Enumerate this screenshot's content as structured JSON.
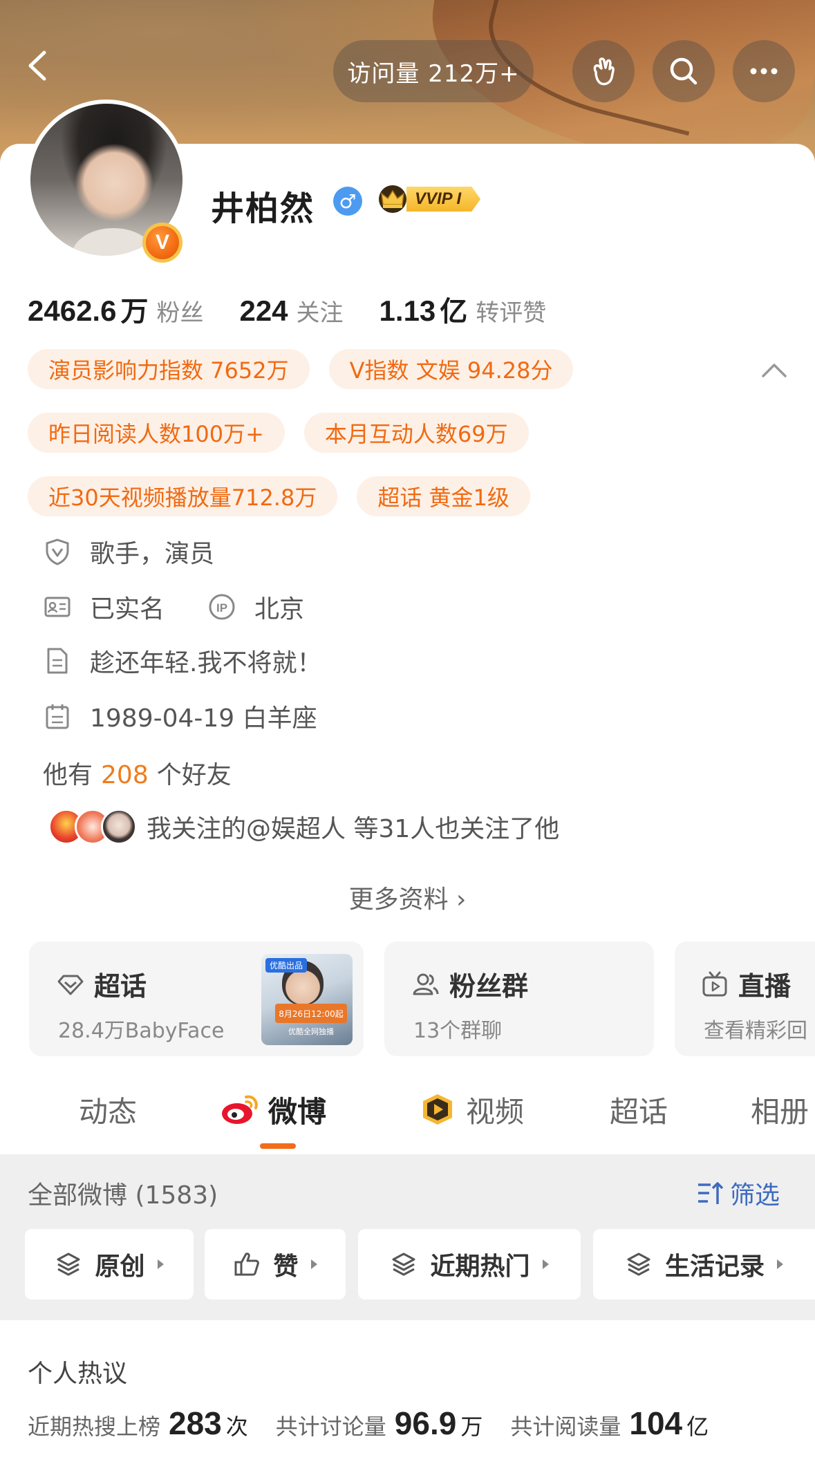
{
  "header": {
    "visit_label": "访问量 212万+"
  },
  "profile": {
    "name": "井柏然",
    "gender_symbol": "♂",
    "vvip_label": "VVIP I",
    "verified_mark": "V"
  },
  "stats": [
    {
      "num": "2462.6",
      "unit": "万",
      "label": "粉丝"
    },
    {
      "num": "224",
      "unit": "",
      "label": "关注"
    },
    {
      "num": "1.13",
      "unit": "亿",
      "label": "转评赞"
    }
  ],
  "tags": {
    "row1": [
      "演员影响力指数 7652万",
      "V指数 文娱 94.28分"
    ],
    "row2": [
      "昨日阅读人数100万+",
      "本月互动人数69万"
    ],
    "row3": [
      "近30天视频播放量712.8万",
      "超话 黄金1级"
    ]
  },
  "info": {
    "occupation": "歌手，演员",
    "real_name": "已实名",
    "ip_location": "北京",
    "bio": "趁还年轻.我不将就！",
    "birthday": "1989-04-19 白羊座"
  },
  "friends": {
    "prefix": "他有",
    "count": "208",
    "suffix": "个好友"
  },
  "mutual": "我关注的@娱超人 等31人也关注了他",
  "more_info": "更多资料 ›",
  "feature_cards": {
    "supertopic": {
      "title": "超话",
      "sub": "28.4万BabyFace"
    },
    "fan_group": {
      "title": "粉丝群",
      "sub": "13个群聊"
    },
    "live": {
      "title": "直播",
      "sub": "查看精彩回"
    },
    "poster": {
      "tag": "优酷出品",
      "band": "8月26日12:00起",
      "sub": "优酷全网独播"
    }
  },
  "tabs": [
    "动态",
    "微博",
    "视频",
    "超话",
    "相册"
  ],
  "weibo_filter": {
    "all_label": "全部微博 (1583)",
    "filter_label": "筛选",
    "chips": [
      "原创",
      "赞",
      "近期热门",
      "生活记录"
    ]
  },
  "hot": {
    "title": "个人热议",
    "items": [
      {
        "label": "近期热搜上榜",
        "num": "283",
        "unit": "次"
      },
      {
        "label": "共计讨论量",
        "num": "96.9",
        "unit": "万"
      },
      {
        "label": "共计阅读量",
        "num": "104",
        "unit": "亿"
      }
    ]
  },
  "colors": {
    "accent_orange": "#f06a12",
    "tag_bg": "#fdf0e6",
    "link_blue": "#3d6bbf",
    "gender_blue": "#4d9bf0"
  }
}
